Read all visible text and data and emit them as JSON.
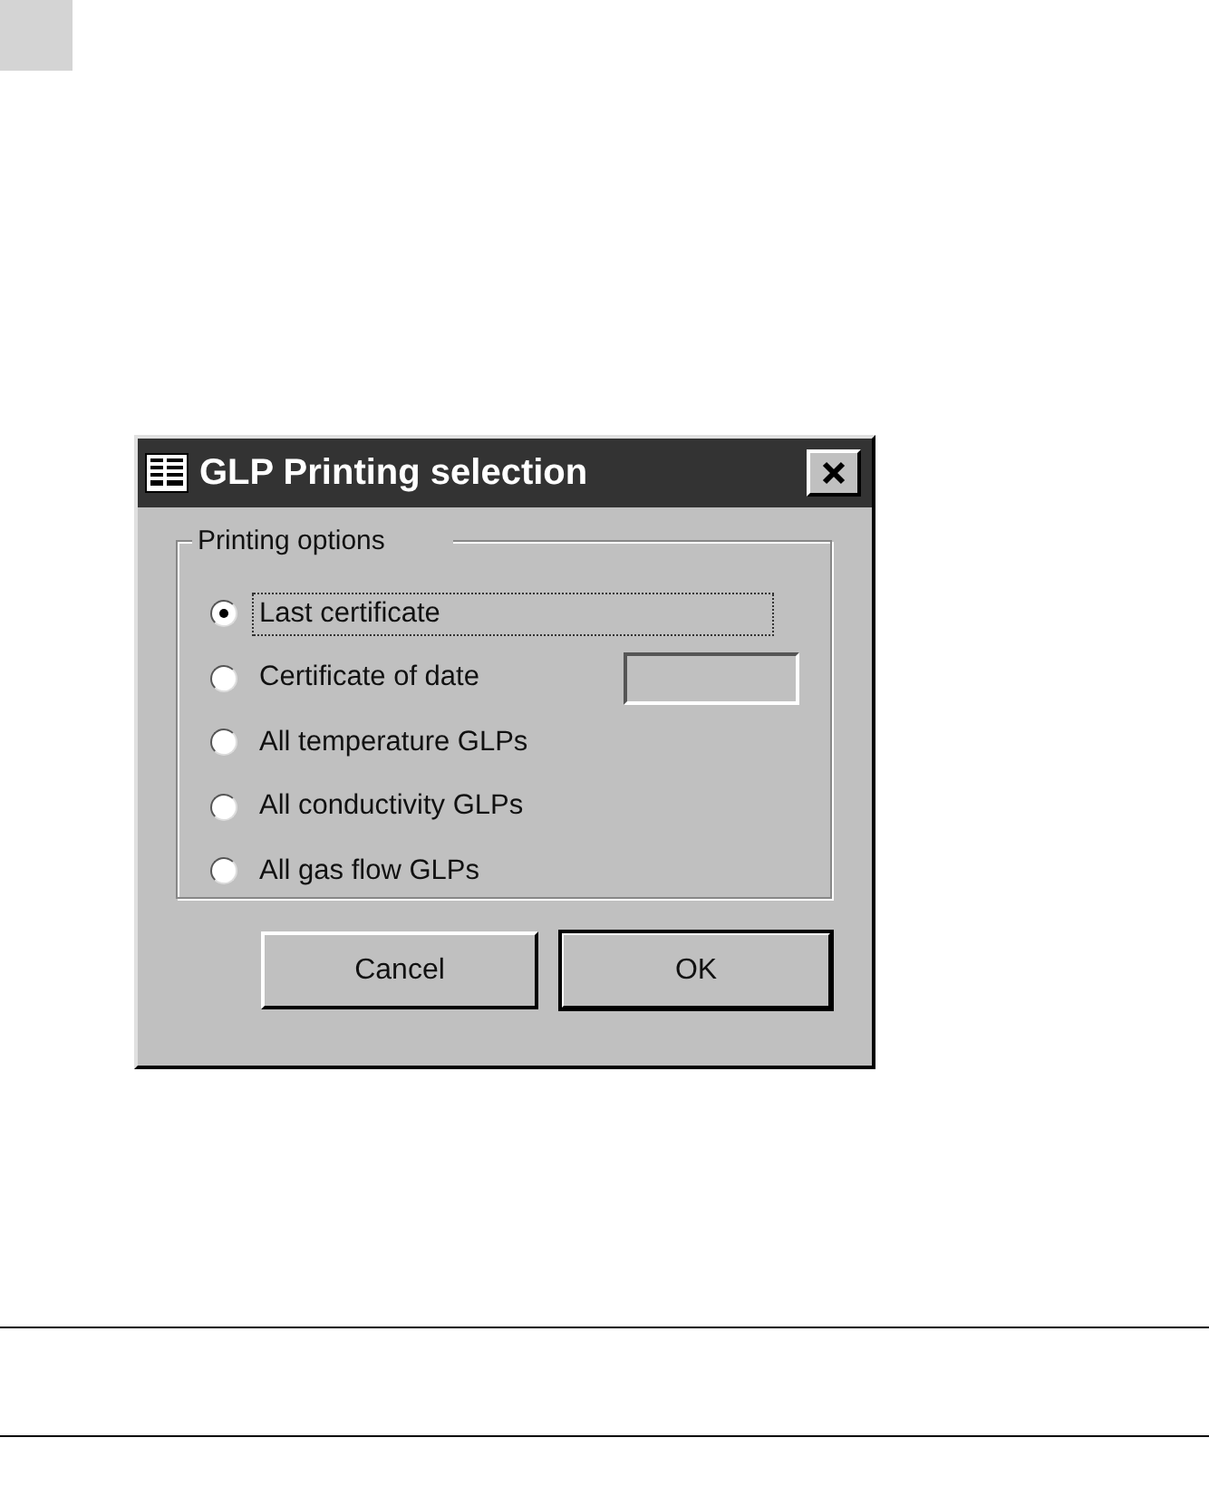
{
  "dialog": {
    "title": "GLP Printing selection",
    "group": {
      "label": "Printing options",
      "options": [
        {
          "label": "Last certificate",
          "selected": true,
          "focused": true,
          "kind": "plain"
        },
        {
          "label": "Certificate of date",
          "selected": false,
          "focused": false,
          "kind": "date"
        },
        {
          "label": "All temperature GLPs",
          "selected": false,
          "focused": false,
          "kind": "plain"
        },
        {
          "label": "All conductivity GLPs",
          "selected": false,
          "focused": false,
          "kind": "plain"
        },
        {
          "label": "All gas flow GLPs",
          "selected": false,
          "focused": false,
          "kind": "plain"
        }
      ]
    },
    "buttons": [
      {
        "label": "Cancel",
        "default": false
      },
      {
        "label": "OK",
        "default": true
      }
    ]
  }
}
